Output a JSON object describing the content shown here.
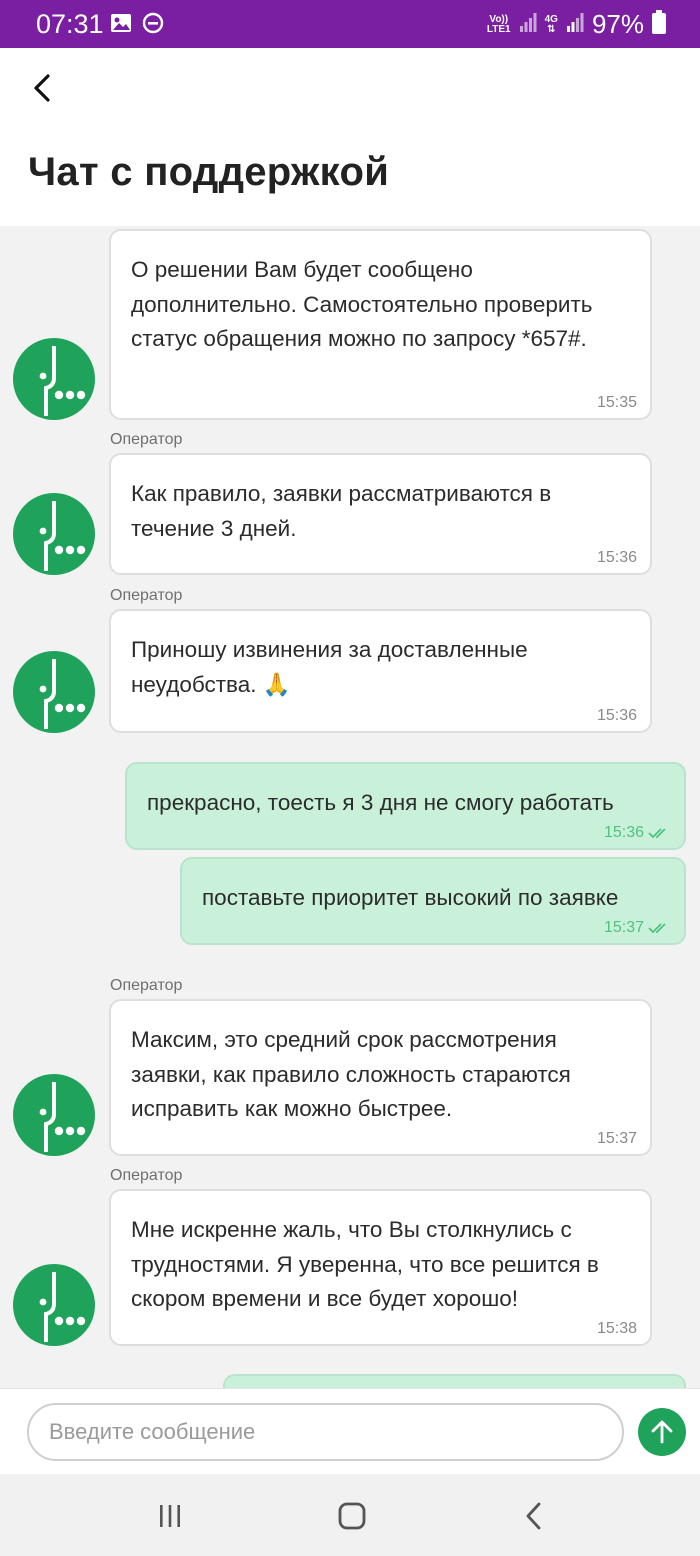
{
  "status_bar": {
    "time": "07:31",
    "network_label_top": "Vo))",
    "network_label_bottom": "LTE1",
    "network_type": "4G",
    "battery": "97%"
  },
  "header": {
    "title": "Чат с поддержкой"
  },
  "colors": {
    "brand_green": "#1fa35b",
    "status_bar": "#7a1fa2",
    "my_bubble": "#c9f1da"
  },
  "messages": [
    {
      "sender": "operator",
      "show_label": false,
      "text": "О решении Вам будет сообщено дополнительно. Самостоятельно проверить статус обращения можно по запросу *657#.",
      "time": "15:35"
    },
    {
      "sender": "operator",
      "label": "Оператор",
      "text": "Как правило, заявки рассматриваются в течение 3 дней.",
      "time": "15:36"
    },
    {
      "sender": "operator",
      "label": "Оператор",
      "text": "Приношу извинения за доставленные неудобства. 🙏",
      "time": "15:36"
    },
    {
      "sender": "me",
      "text": "прекрасно, тоесть я 3 дня не смогу работать",
      "time": "15:36"
    },
    {
      "sender": "me",
      "text": "поставьте приоритет высокий по заявке",
      "time": "15:37"
    },
    {
      "sender": "operator",
      "label": "Оператор",
      "text": "Максим, это средний срок рассмотрения заявки, как правило сложность стараются исправить как можно быстрее.",
      "time": "15:37"
    },
    {
      "sender": "operator",
      "label": "Оператор",
      "text": "Мне искренне жаль, что Вы столкнулись с трудностями. Я уверенна, что все решится в скором времени и все будет хорошо!",
      "time": "15:38"
    }
  ],
  "composer": {
    "placeholder": "Введите сообщение",
    "value": ""
  },
  "icons": {
    "back": "back-arrow-icon",
    "send": "send-arrow-up-icon",
    "avatar": "megafon-logo-icon"
  }
}
